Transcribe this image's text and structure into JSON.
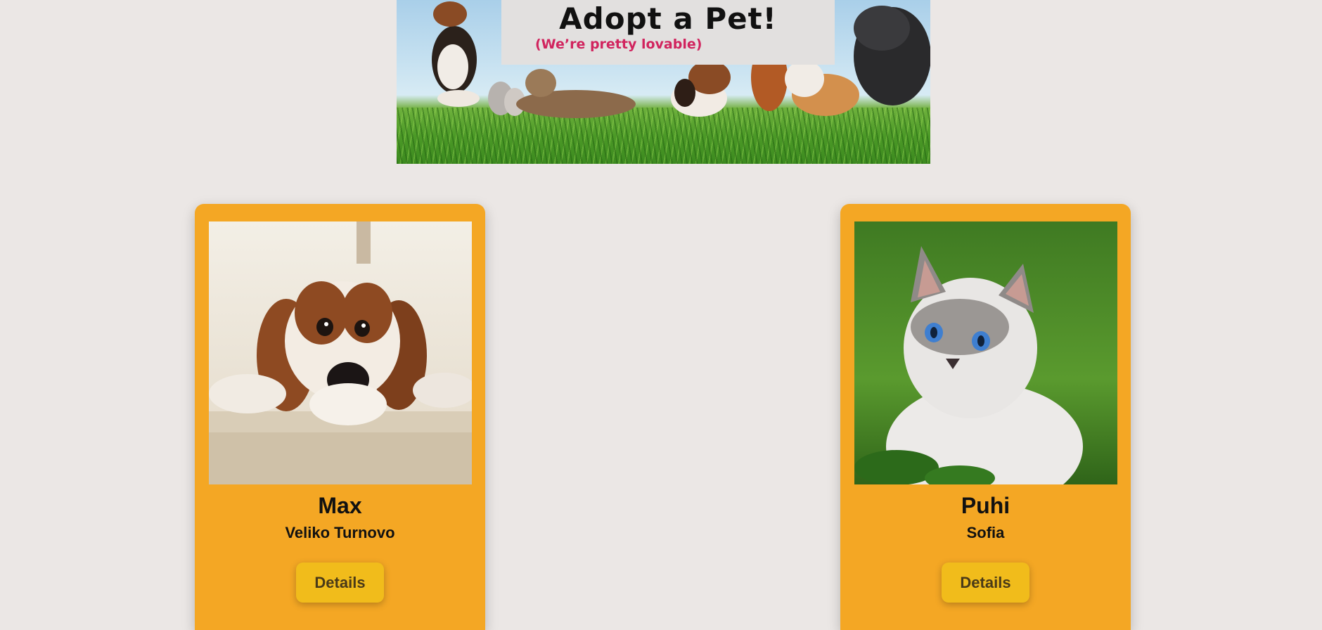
{
  "banner": {
    "title": "Adopt a Pet!",
    "subtitle": "(We’re pretty lovable)"
  },
  "pets": [
    {
      "name": "Max",
      "location": "Veliko Turnovo",
      "button_label": "Details",
      "photo": "spaniel-dog-photo"
    },
    {
      "name": "Puhi",
      "location": "Sofia",
      "button_label": "Details",
      "photo": "white-cat-photo"
    }
  ],
  "colors": {
    "page_background": "#ebe7e5",
    "card": "#f4a724",
    "button": "#f1bc1b",
    "subtitle": "#d1245e"
  }
}
